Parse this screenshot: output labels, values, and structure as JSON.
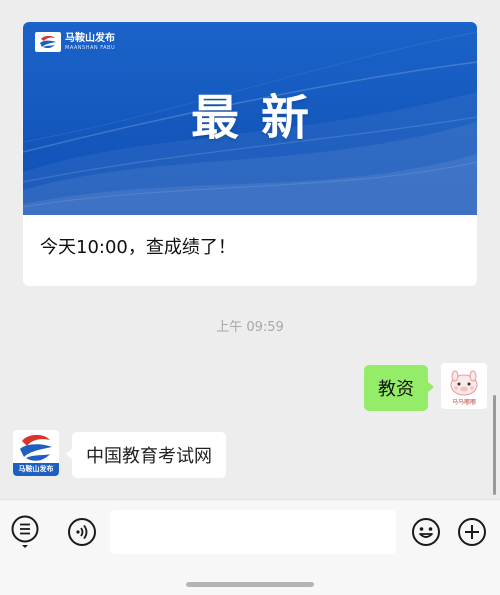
{
  "article": {
    "logo_cn": "马鞍山发布",
    "logo_en": "MAANSHAN FABU",
    "banner_title": "最新",
    "caption": "今天10:00，查成绩了！"
  },
  "timestamp": "上午 09:59",
  "messages": {
    "outgoing": {
      "text": "教资",
      "avatar_label": "马马嘟嘟"
    },
    "incoming": {
      "text": "中国教育考试网",
      "avatar_label": "马鞍山发布"
    }
  },
  "input_bar": {
    "value": "",
    "left_icon": "menu-list-icon",
    "voice_icon": "voice-icon",
    "emoji_icon": "emoji-icon",
    "plus_icon": "plus-icon"
  },
  "colors": {
    "banner_blue": "#1458bd",
    "bubble_green": "#95ec69",
    "background": "#ededed"
  }
}
